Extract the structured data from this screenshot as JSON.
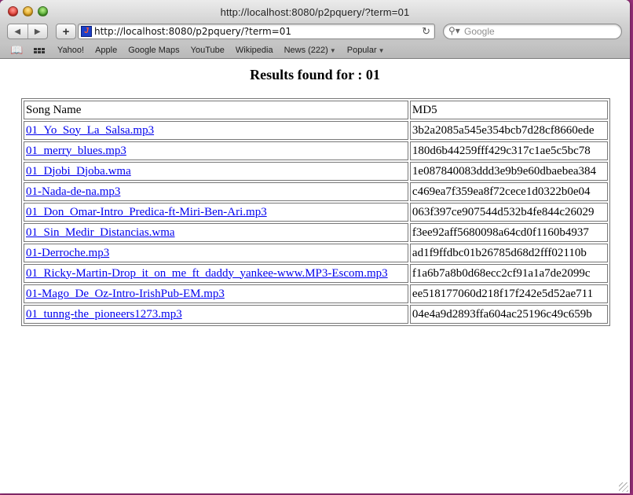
{
  "window": {
    "title": "http://localhost:8080/p2pquery/?term=01"
  },
  "toolbar": {
    "back_icon": "◀",
    "forward_icon": "▶",
    "add_icon": "+",
    "url": "http://localhost:8080/p2pquery/?term=01",
    "reload_icon": "↻",
    "search_placeholder": "Google",
    "search_icon": "search-icon"
  },
  "bookmarks": {
    "items": [
      {
        "label": "Yahoo!"
      },
      {
        "label": "Apple"
      },
      {
        "label": "Google Maps"
      },
      {
        "label": "YouTube"
      },
      {
        "label": "Wikipedia"
      },
      {
        "label": "News (222)",
        "menu": true
      },
      {
        "label": "Popular",
        "menu": true
      }
    ]
  },
  "page": {
    "heading": "Results found for : 01"
  },
  "table": {
    "headers": [
      "Song Name",
      "MD5"
    ],
    "rows": [
      {
        "song": "01_Yo_Soy_La_Salsa.mp3",
        "md5": "3b2a2085a545e354bcb7d28cf8660ede"
      },
      {
        "song": "01_merry_blues.mp3",
        "md5": "180d6b44259fff429c317c1ae5c5bc78"
      },
      {
        "song": "01_Djobi_Djoba.wma",
        "md5": "1e087840083ddd3e9b9e60dbaebea384"
      },
      {
        "song": "01-Nada-de-na.mp3",
        "md5": "c469ea7f359ea8f72cece1d0322b0e04"
      },
      {
        "song": "01_Don_Omar-Intro_Predica-ft-Miri-Ben-Ari.mp3",
        "md5": "063f397ce907544d532b4fe844c26029"
      },
      {
        "song": "01_Sin_Medir_Distancias.wma",
        "md5": "f3ee92aff5680098a64cd0f1160b4937"
      },
      {
        "song": "01-Derroche.mp3",
        "md5": "ad1f9ffdbc01b26785d68d2fff02110b"
      },
      {
        "song": "01_Ricky-Martin-Drop_it_on_me_ft_daddy_yankee-www.MP3-Escom.mp3",
        "md5": "f1a6b7a8b0d68ecc2cf91a1a7de2099c"
      },
      {
        "song": "01-Mago_De_Oz-Intro-IrishPub-EM.mp3",
        "md5": "ee518177060d218f17f242e5d52ae711"
      },
      {
        "song": "01_tunng-the_pioneers1273.mp3",
        "md5": "04e4a9d2893ffa604ac25196c49c659b"
      }
    ]
  }
}
